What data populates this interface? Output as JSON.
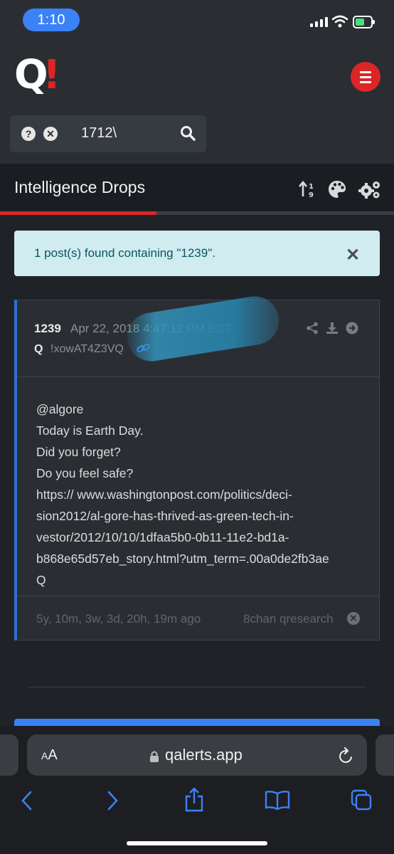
{
  "status_bar": {
    "time": "1:10"
  },
  "header": {
    "logo_q": "Q",
    "logo_bang": "!"
  },
  "search": {
    "value": "1712\\"
  },
  "section": {
    "title": "Intelligence Drops"
  },
  "alert": {
    "text": "1 post(s) found containing \"1239\"."
  },
  "post": {
    "number": "1239",
    "date": "Apr 22, 2018 4:47:12 PM EDT",
    "author": "Q",
    "tripcode": "!xowAT4Z3VQ",
    "body_lines": [
      "@algore",
      "Today is Earth Day.",
      "Did you forget?",
      "Do you feel safe?",
      "https:// www.washingtonpost.com/politics/deci-",
      "sion2012/al-gore-has-thrived-as-green-tech-in-",
      "vestor/2012/10/10/1dfaa5b0-0b11-11e2-bd1a-",
      "b868e65d57eb_story.html?utm_term=.00a0de2fb3ae",
      "Q"
    ],
    "ago": "5y, 10m, 3w, 3d, 20h, 19m ago",
    "source": "8chan qresearch"
  },
  "browser": {
    "aa_label_small": "A",
    "aa_label": "A",
    "url": "qalerts.app"
  },
  "colors": {
    "accent_red": "#dc2626",
    "link_blue": "#3b82f6",
    "alert_bg": "#d1ecf1"
  }
}
